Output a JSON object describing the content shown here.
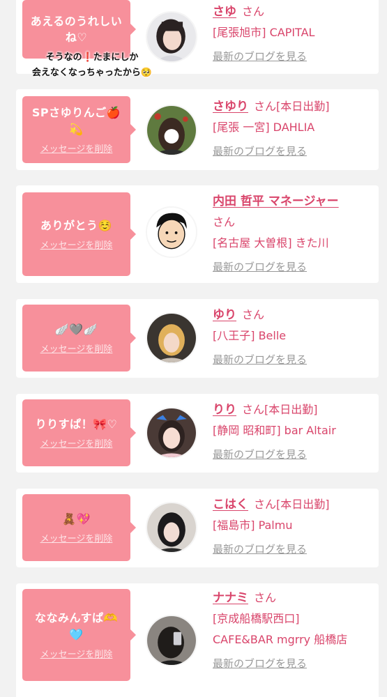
{
  "story_overlay": {
    "line1": "そうなの❗たまにしか",
    "line2": "会えなくなっちゃったから🥺"
  },
  "common": {
    "delete_label": "メッセージを削除",
    "san_suffix": "さん",
    "blog_link": "最新のブログを見る"
  },
  "cards": [
    {
      "message": "あえるのうれしいね♡",
      "name": "さゆ",
      "status": "",
      "shop": "[尾張旭市] CAPITAL",
      "avatar": "photo-girl-1"
    },
    {
      "message": "SPさゆりんご🍎💫",
      "name": "さゆり",
      "status": "[本日出勤]",
      "shop": "[尾張 一宮] DAHLIA",
      "avatar": "photo-girl-2"
    },
    {
      "message": "ありがとう☺️",
      "name": "内田 哲平 マネージャー",
      "status": "",
      "shop": "[名古屋 大曽根] きた川",
      "avatar": "illustration-man"
    },
    {
      "message": "🪽🩶🪽",
      "name": "ゆり",
      "status": "",
      "shop": "[八王子] Belle",
      "avatar": "photo-girl-3"
    },
    {
      "message": "りりすぱ！🎀♡",
      "name": "りり",
      "status": "[本日出勤]",
      "shop": "[静岡 昭和町] bar Altair",
      "avatar": "photo-girl-4"
    },
    {
      "message": "🧸💖",
      "name": "こはく",
      "status": "[本日出勤]",
      "shop": "[福島市] Palmu",
      "avatar": "photo-girl-5"
    },
    {
      "message": "ななみんすぱ🫶🩵",
      "name": "ナナミ",
      "status": "",
      "shop": "[京成船橋駅西口] CAFE&BAR mgrry 船橋店",
      "avatar": "photo-girl-6"
    }
  ]
}
